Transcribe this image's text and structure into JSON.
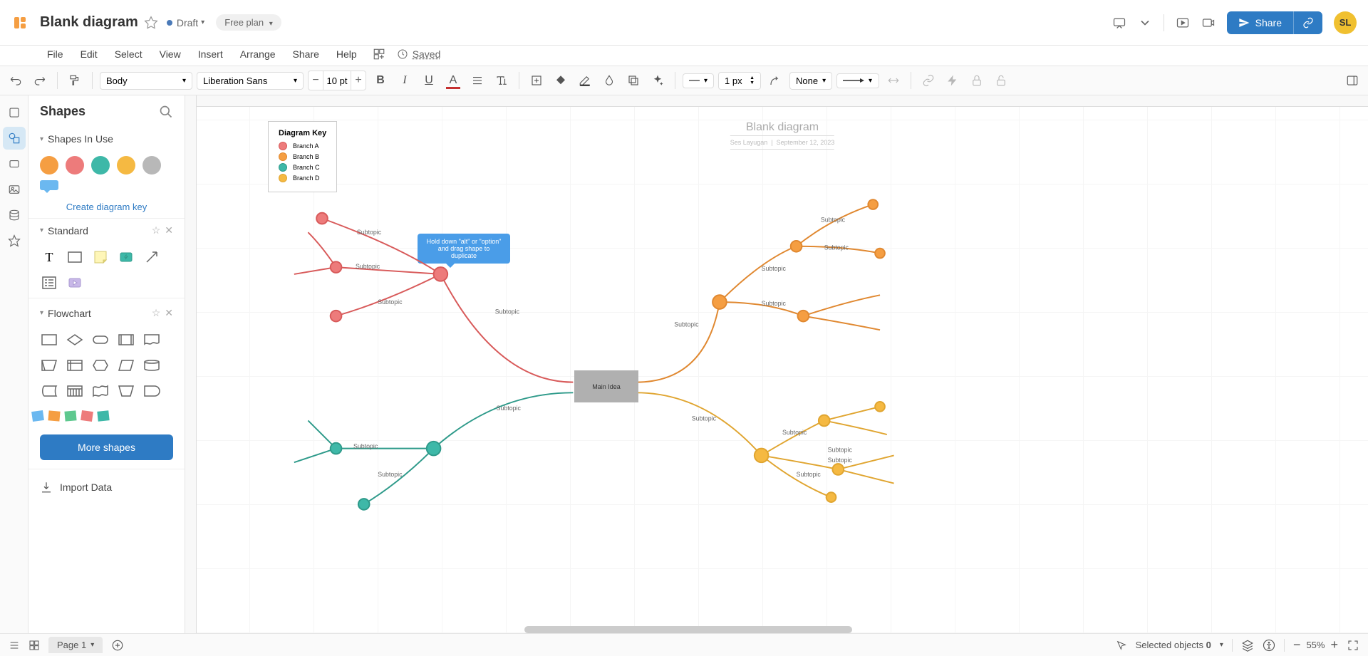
{
  "doc": {
    "title": "Blank diagram",
    "draft_label": "Draft",
    "plan_label": "Free plan",
    "saved_label": "Saved"
  },
  "menu": {
    "file": "File",
    "edit": "Edit",
    "select": "Select",
    "view": "View",
    "insert": "Insert",
    "arrange": "Arrange",
    "share": "Share",
    "help": "Help"
  },
  "toolbar": {
    "shape_style": "Body",
    "font_family": "Liberation Sans",
    "font_size": "10 pt",
    "stroke_width": "1 px",
    "line_style": "None"
  },
  "header": {
    "share_btn": "Share",
    "avatar_initials": "SL"
  },
  "shapes_panel": {
    "title": "Shapes",
    "sections": {
      "in_use": "Shapes In Use",
      "standard": "Standard",
      "flowchart": "Flowchart"
    },
    "swatches": [
      "#f59e42",
      "#ed7b7b",
      "#3eb8a8",
      "#f5b942",
      "#b8b8b8"
    ],
    "create_key": "Create diagram key",
    "more_shapes": "More shapes",
    "import_data": "Import Data"
  },
  "canvas": {
    "title": "Blank diagram",
    "subtitle_author": "Ses Layugan",
    "subtitle_date": "September 12, 2023",
    "key": {
      "title": "Diagram Key",
      "items": [
        {
          "label": "Branch A",
          "fill": "#ed7b7b",
          "border": "#d85a5a"
        },
        {
          "label": "Branch B",
          "fill": "#f59e42",
          "border": "#e08830"
        },
        {
          "label": "Branch C",
          "fill": "#3eb8a8",
          "border": "#2e9a8a"
        },
        {
          "label": "Branch D",
          "fill": "#f5b942",
          "border": "#e0a530"
        }
      ]
    },
    "tooltip": "Hold down \"alt\" or \"option\" and drag shape to duplicate",
    "main_idea": "Main Idea",
    "subtopic_label": "Subtopic",
    "branches": {
      "a": {
        "color": "#ed7b7b",
        "stroke": "#d85a5a"
      },
      "b": {
        "color": "#f59e42",
        "stroke": "#e08830"
      },
      "c": {
        "color": "#3eb8a8",
        "stroke": "#2e9a8a"
      },
      "d": {
        "color": "#f5b942",
        "stroke": "#e0a530"
      }
    }
  },
  "bottombar": {
    "page_label": "Page 1",
    "selected_label": "Selected objects",
    "selected_count": "0",
    "zoom": "55%"
  }
}
